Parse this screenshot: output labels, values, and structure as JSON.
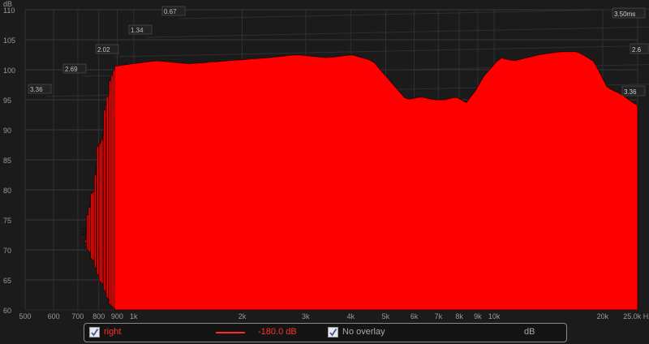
{
  "chart_data": {
    "type": "waterfall",
    "title": "",
    "x_axis": {
      "unit": "Hz",
      "range": [
        500,
        25000
      ],
      "scale": "log",
      "tick_labels": [
        "500",
        "600",
        "700",
        "800",
        "900",
        "1k",
        "2k",
        "3k",
        "4k",
        "5k",
        "6k",
        "7k",
        "8k",
        "9k",
        "10k",
        "20k",
        "25.0k Hz"
      ],
      "tick_values": [
        500,
        600,
        700,
        800,
        900,
        1000,
        2000,
        3000,
        4000,
        5000,
        6000,
        7000,
        8000,
        9000,
        10000,
        20000,
        25000
      ]
    },
    "y_axis": {
      "unit": "dB",
      "range": [
        60,
        110
      ],
      "tick_labels": [
        "60",
        "65",
        "70",
        "75",
        "80",
        "85",
        "90",
        "95",
        "100",
        "105",
        "110"
      ],
      "label": "dB"
    },
    "time_axis": {
      "unit": "ms",
      "range": [
        0,
        3.5
      ],
      "left_tick_labels": [
        "3.36",
        "2.69",
        "2.02",
        "1.34",
        "0.67"
      ],
      "right_tick_labels": [
        "3.50ms",
        "2.6",
        "3.36"
      ]
    },
    "series_color": "#ff0000",
    "slice_count": 47,
    "front_slice": {
      "freq": [
        500,
        700,
        900,
        1200,
        1600,
        2000,
        2500,
        3000,
        3500,
        4000,
        4500,
        5000,
        5500,
        6000,
        6500,
        7000,
        7500,
        8000,
        9000,
        10000,
        11000,
        12000,
        14000,
        16000,
        18000,
        20000,
        22000,
        25000
      ],
      "db": [
        100.5,
        101.5,
        101.0,
        101.5,
        102.0,
        102.5,
        102.0,
        102.5,
        101.5,
        98.0,
        95.0,
        95.5,
        95.0,
        95.0,
        95.5,
        94.5,
        96.5,
        99.0,
        102.0,
        101.5,
        102.0,
        102.5,
        103.0,
        103.0,
        101.5,
        97.0,
        96.0,
        94.0
      ]
    },
    "back_slice": {
      "freq": [
        700,
        800,
        900,
        1000,
        1200,
        1600,
        2000,
        2500,
        3000,
        3500,
        4000,
        4500,
        5000,
        5500,
        6000,
        7000,
        8000,
        9000,
        10000,
        12000,
        15000,
        20000,
        25000
      ],
      "db": [
        66.5,
        67.0,
        66.0,
        65.5,
        65.0,
        64.5,
        64.0,
        63.5,
        64.0,
        63.0,
        62.5,
        62.5,
        62.0,
        62.0,
        62.0,
        61.5,
        61.5,
        61.0,
        61.0,
        61.0,
        61.0,
        61.0,
        61.0
      ]
    }
  },
  "legend": {
    "series_checked": true,
    "series_name": "right",
    "series_level": "-180.0 dB",
    "overlay_checked": true,
    "overlay_label": "No overlay",
    "unit_label": "dB",
    "series_color": "#ff2a2a"
  }
}
